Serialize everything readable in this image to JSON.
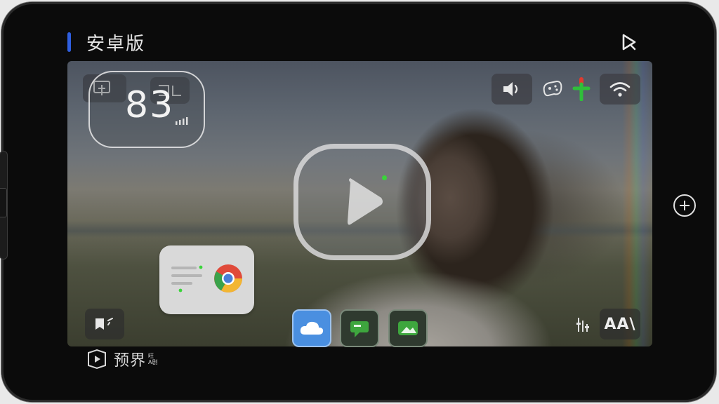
{
  "header": {
    "title": "安卓版",
    "accent_color": "#2f5fe0",
    "cast_icon": "cast-play-icon"
  },
  "overlay": {
    "speed_value": "83",
    "speed_icon": "signal-bars-icon",
    "top_left_icons": [
      "screen-add-icon",
      "mirror-icon"
    ],
    "top_right_icons": [
      "speaker-icon",
      "gamepad-icon",
      "mic-icon",
      "wifi-icon"
    ],
    "play_icon": "play-icon",
    "recording_indicator_color": "#3ad43a"
  },
  "card": {
    "app_icon": "chrome-icon",
    "content_icon": "text-lines-icon"
  },
  "bottom_left": {
    "icon": "tag-icon"
  },
  "bottom_right": {
    "adjust_icon": "equalizer-icon",
    "font_button_label": "AA\\"
  },
  "dock": {
    "apps": [
      {
        "icon": "cloud-icon",
        "color": "#4a8fe0"
      },
      {
        "icon": "chat-icon",
        "color": "#3ea63e"
      },
      {
        "icon": "photo-icon",
        "color": "#3ea63e"
      }
    ]
  },
  "side": {
    "add_icon": "plus-circle-icon"
  },
  "brand": {
    "name": "预界",
    "small_top": "旺",
    "small_bottom": "A剧"
  }
}
